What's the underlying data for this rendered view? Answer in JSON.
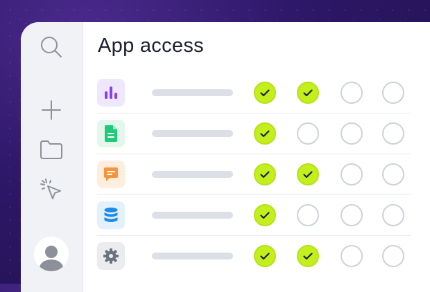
{
  "page": {
    "title": "App access"
  },
  "sidebar": {
    "items": [
      {
        "name": "search",
        "icon": "search-icon"
      },
      {
        "name": "add",
        "icon": "plus-icon"
      },
      {
        "name": "folder",
        "icon": "folder-icon"
      },
      {
        "name": "pointer",
        "icon": "cursor-click-icon"
      }
    ],
    "avatar_icon": "user-avatar-icon"
  },
  "apps": [
    {
      "icon": "bar-chart-icon",
      "icon_color": "#8b3ff5",
      "icon_bg": "#efe7fd",
      "permissions": [
        true,
        true,
        false,
        false
      ]
    },
    {
      "icon": "document-icon",
      "icon_color": "#1fca7a",
      "icon_bg": "#e3f7ec",
      "permissions": [
        true,
        false,
        false,
        false
      ]
    },
    {
      "icon": "message-icon",
      "icon_color": "#fb923c",
      "icon_bg": "#ffeedd",
      "permissions": [
        true,
        true,
        false,
        false
      ]
    },
    {
      "icon": "database-icon",
      "icon_color": "#1d8ce6",
      "icon_bg": "#e3f1fc",
      "permissions": [
        true,
        false,
        false,
        false
      ]
    },
    {
      "icon": "gear-icon",
      "icon_color": "#6b7280",
      "icon_bg": "#ececef",
      "permissions": [
        true,
        true,
        false,
        false
      ]
    }
  ],
  "colors": {
    "checked_fill": "#c3f01d",
    "unchecked_border": "#cdd1d9",
    "background": "#2d1767"
  }
}
